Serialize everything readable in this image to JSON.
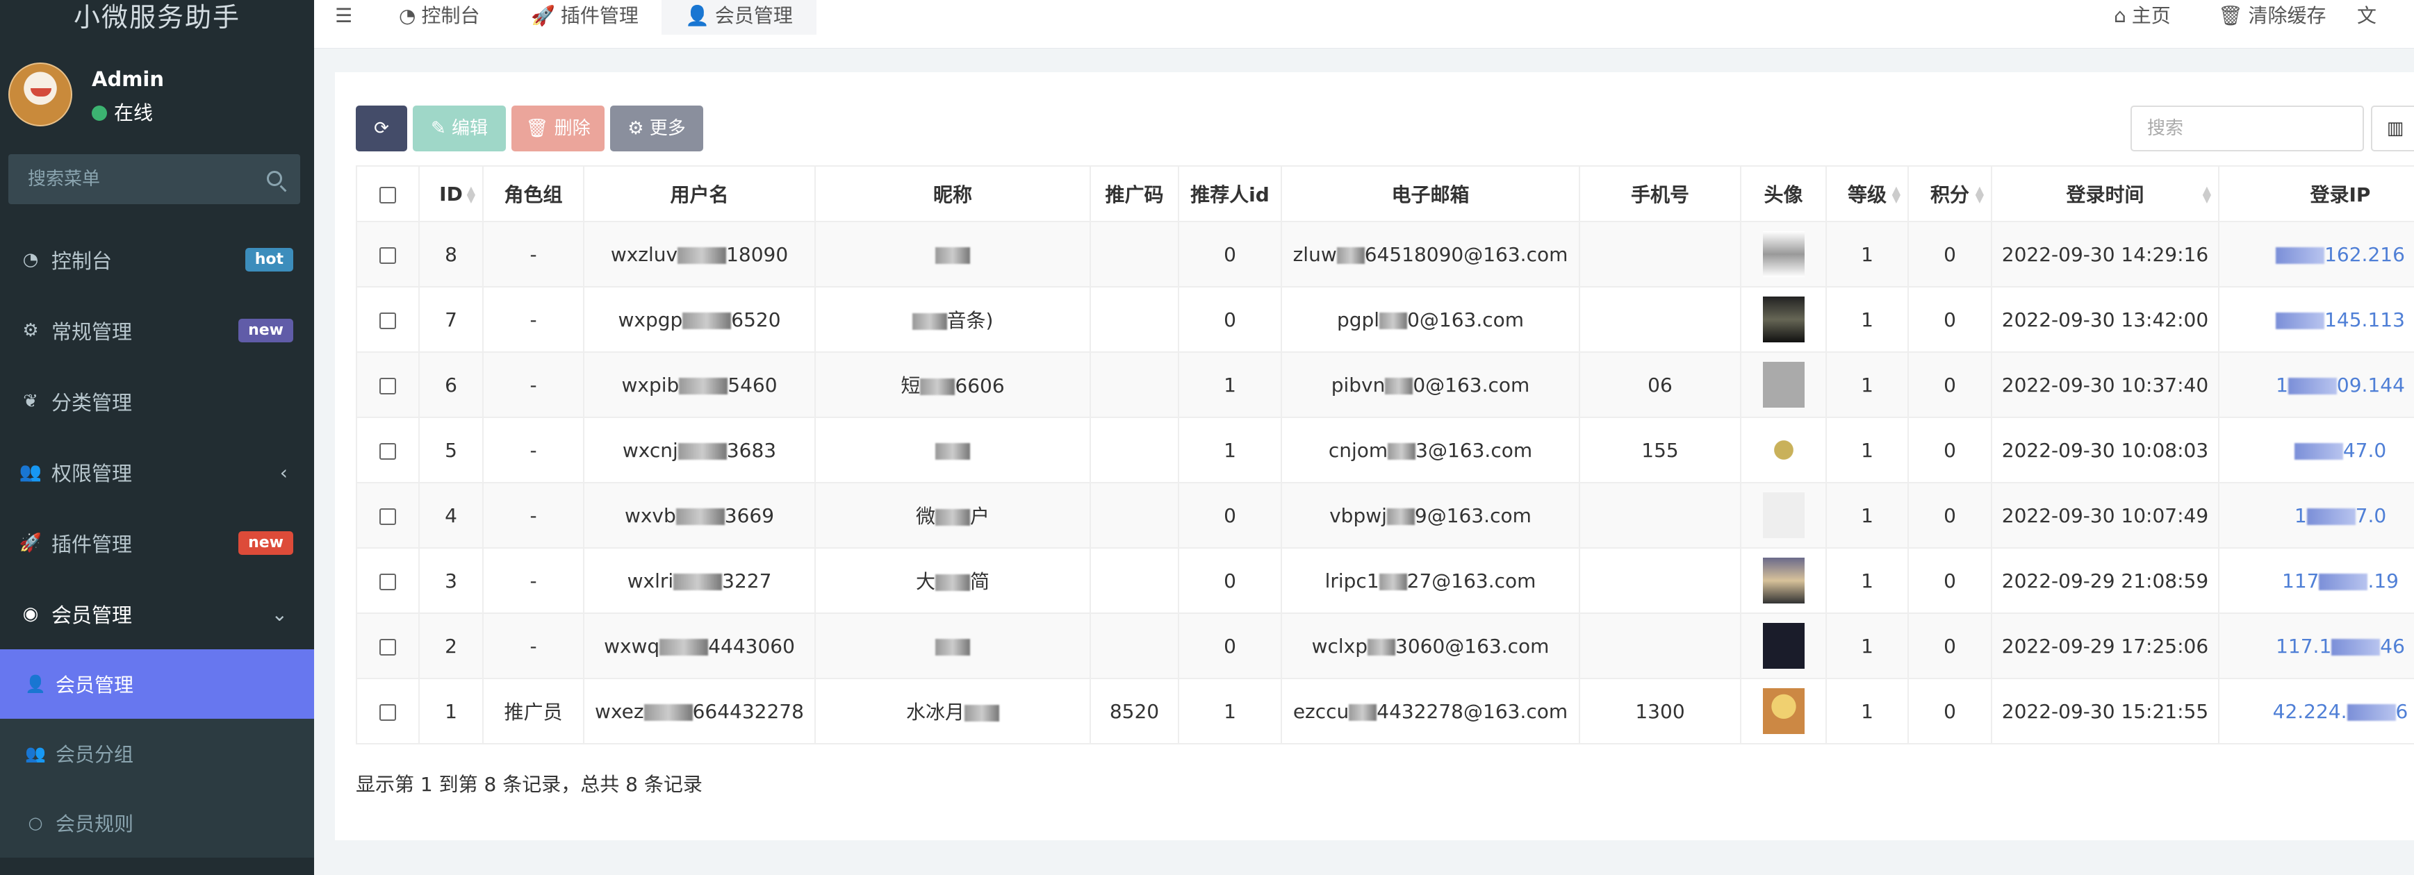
{
  "app": {
    "title": "小微服务助手"
  },
  "user": {
    "name": "Admin",
    "status": "在线"
  },
  "sidebar": {
    "search_placeholder": "搜索菜单",
    "items": [
      {
        "label": "控制台",
        "badge": "hot"
      },
      {
        "label": "常规管理",
        "badge": "new"
      },
      {
        "label": "分类管理"
      },
      {
        "label": "权限管理"
      },
      {
        "label": "插件管理",
        "badge": "new"
      },
      {
        "label": "会员管理"
      }
    ],
    "subitems": [
      {
        "label": "会员管理"
      },
      {
        "label": "会员分组"
      },
      {
        "label": "会员规则"
      }
    ]
  },
  "navbar": {
    "tabs": [
      {
        "label": "控制台"
      },
      {
        "label": "插件管理"
      },
      {
        "label": "会员管理"
      }
    ],
    "home": "主页",
    "clear_cache": "清除缓存"
  },
  "toolbar": {
    "edit": "编辑",
    "delete": "删除",
    "more": "更多",
    "search_placeholder": "搜索"
  },
  "table": {
    "headers": [
      "ID",
      "角色组",
      "用户名",
      "昵称",
      "推广码",
      "推荐人id",
      "电子邮箱",
      "手机号",
      "头像",
      "等级",
      "积分",
      "登录时间",
      "登录IP"
    ],
    "rows": [
      {
        "id": "8",
        "group": "-",
        "username_a": "wxzluv",
        "username_b": "18090",
        "nick_a": "",
        "nick_b": "",
        "promo": "",
        "ref": "0",
        "email_a": "zluw",
        "email_b": "64518090@163.com",
        "phone_a": "",
        "phone_b": "",
        "level": "1",
        "score": "0",
        "time": "2022-09-30 14:29:16",
        "ip_a": "",
        "ip_b": "162.216"
      },
      {
        "id": "7",
        "group": "-",
        "username_a": "wxpgp",
        "username_b": "6520",
        "nick_a": "",
        "nick_b": "音条)",
        "promo": "",
        "ref": "0",
        "email_a": "pgpl",
        "email_b": "0@163.com",
        "phone_a": "",
        "phone_b": "",
        "level": "1",
        "score": "0",
        "time": "2022-09-30 13:42:00",
        "ip_a": "",
        "ip_b": "145.113"
      },
      {
        "id": "6",
        "group": "-",
        "username_a": "wxpib",
        "username_b": "5460",
        "nick_a": "短",
        "nick_b": "6606",
        "promo": "",
        "ref": "1",
        "email_a": "pibvn",
        "email_b": "0@163.com",
        "phone_a": "",
        "phone_b": "06",
        "level": "1",
        "score": "0",
        "time": "2022-09-30 10:37:40",
        "ip_a": "1",
        "ip_b": "09.144"
      },
      {
        "id": "5",
        "group": "-",
        "username_a": "wxcnj",
        "username_b": "3683",
        "nick_a": "",
        "nick_b": "",
        "promo": "",
        "ref": "1",
        "email_a": "cnjom",
        "email_b": "3@163.com",
        "phone_a": "15",
        "phone_b": "5",
        "level": "1",
        "score": "0",
        "time": "2022-09-30 10:08:03",
        "ip_a": "",
        "ip_b": "47.0"
      },
      {
        "id": "4",
        "group": "-",
        "username_a": "wxvb",
        "username_b": "3669",
        "nick_a": "微",
        "nick_b": "户",
        "promo": "",
        "ref": "0",
        "email_a": "vbpwj",
        "email_b": "9@163.com",
        "phone_a": "",
        "phone_b": "",
        "level": "1",
        "score": "0",
        "time": "2022-09-30 10:07:49",
        "ip_a": "1",
        "ip_b": "7.0"
      },
      {
        "id": "3",
        "group": "-",
        "username_a": "wxlri",
        "username_b": "3227",
        "nick_a": "大",
        "nick_b": "简",
        "promo": "",
        "ref": "0",
        "email_a": "lripc1",
        "email_b": "27@163.com",
        "phone_a": "",
        "phone_b": "",
        "level": "1",
        "score": "0",
        "time": "2022-09-29 21:08:59",
        "ip_a": "117",
        "ip_b": ".19"
      },
      {
        "id": "2",
        "group": "-",
        "username_a": "wxwq",
        "username_b": "4443060",
        "nick_a": "",
        "nick_b": "",
        "promo": "",
        "ref": "0",
        "email_a": "wclxp",
        "email_b": "3060@163.com",
        "phone_a": "",
        "phone_b": "",
        "level": "1",
        "score": "0",
        "time": "2022-09-29 17:25:06",
        "ip_a": "117.1",
        "ip_b": "46"
      },
      {
        "id": "1",
        "group": "推广员",
        "username_a": "wxez",
        "username_b": "664432278",
        "nick_a": "水冰月",
        "nick_b": "",
        "promo": "8520",
        "ref": "1",
        "email_a": "ezccu",
        "email_b": "4432278@163.com",
        "phone_a": "13",
        "phone_b": "00",
        "level": "1",
        "score": "0",
        "time": "2022-09-30 15:21:55",
        "ip_a": "42.224.",
        "ip_b": "6"
      }
    ]
  },
  "footer": {
    "summary": "显示第 1 到第 8 条记录，总共 8 条记录"
  }
}
